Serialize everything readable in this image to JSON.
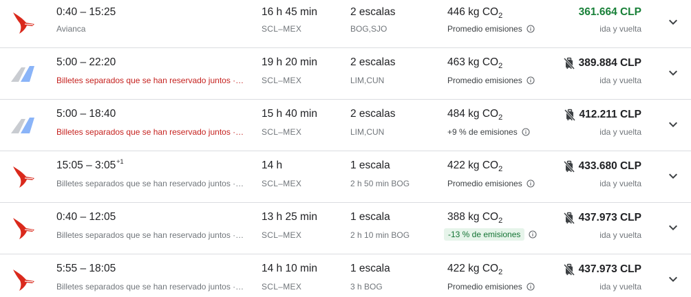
{
  "colors": {
    "warning_text": "#c5221f",
    "price_green": "#188038",
    "emission_badge_bg": "#e6f4ea",
    "emission_badge_text": "#137333",
    "avianca_red": "#da291c",
    "logo_blue": "#8ab4f8"
  },
  "flights": [
    {
      "airline_icon": "avianca-logo-icon",
      "time": "0:40 – 15:25",
      "time_suffix": "",
      "subtitle": "Avianca",
      "subtitle_is_warning": false,
      "duration": "16 h 45 min",
      "route": "SCL–MEX",
      "stops": "2 escalas",
      "stop_details": "BOG,SJO",
      "co2_value": "446 kg CO",
      "co2_subscript": "2",
      "emissions": "Promedio emisiones",
      "emissions_badge": false,
      "price": "361.664 CLP",
      "price_is_green": true,
      "no_bag_icon": false,
      "trip_type": "ida y vuelta"
    },
    {
      "airline_icon": "multi-airline-logo-icon",
      "time": "5:00 – 22:20",
      "time_suffix": "",
      "subtitle": "Billetes separados que se han reservado juntos ·…",
      "subtitle_is_warning": true,
      "duration": "19 h 20 min",
      "route": "SCL–MEX",
      "stops": "2 escalas",
      "stop_details": "LIM,CUN",
      "co2_value": "463 kg CO",
      "co2_subscript": "2",
      "emissions": "Promedio emisiones",
      "emissions_badge": false,
      "price": "389.884 CLP",
      "price_is_green": false,
      "no_bag_icon": true,
      "trip_type": "ida y vuelta"
    },
    {
      "airline_icon": "multi-airline-logo-icon",
      "time": "5:00 – 18:40",
      "time_suffix": "",
      "subtitle": "Billetes separados que se han reservado juntos ·…",
      "subtitle_is_warning": true,
      "duration": "15 h 40 min",
      "route": "SCL–MEX",
      "stops": "2 escalas",
      "stop_details": "LIM,CUN",
      "co2_value": "484 kg CO",
      "co2_subscript": "2",
      "emissions": "+9 % de emisiones",
      "emissions_badge": false,
      "price": "412.211 CLP",
      "price_is_green": false,
      "no_bag_icon": true,
      "trip_type": "ida y vuelta"
    },
    {
      "airline_icon": "avianca-logo-icon",
      "time": "15:05 – 3:05",
      "time_suffix": "+1",
      "subtitle": "Billetes separados que se han reservado juntos ·…",
      "subtitle_is_warning": false,
      "duration": "14 h",
      "route": "SCL–MEX",
      "stops": "1 escala",
      "stop_details": "2 h 50 min BOG",
      "co2_value": "422 kg CO",
      "co2_subscript": "2",
      "emissions": "Promedio emisiones",
      "emissions_badge": false,
      "price": "433.680 CLP",
      "price_is_green": false,
      "no_bag_icon": true,
      "trip_type": "ida y vuelta"
    },
    {
      "airline_icon": "avianca-logo-icon",
      "time": "0:40 – 12:05",
      "time_suffix": "",
      "subtitle": "Billetes separados que se han reservado juntos ·…",
      "subtitle_is_warning": false,
      "duration": "13 h 25 min",
      "route": "SCL–MEX",
      "stops": "1 escala",
      "stop_details": "2 h 10 min BOG",
      "co2_value": "388 kg CO",
      "co2_subscript": "2",
      "emissions": "-13 % de emisiones",
      "emissions_badge": true,
      "price": "437.973 CLP",
      "price_is_green": false,
      "no_bag_icon": true,
      "trip_type": "ida y vuelta"
    },
    {
      "airline_icon": "avianca-logo-icon",
      "time": "5:55 – 18:05",
      "time_suffix": "",
      "subtitle": "Billetes separados que se han reservado juntos ·…",
      "subtitle_is_warning": false,
      "duration": "14 h 10 min",
      "route": "SCL–MEX",
      "stops": "1 escala",
      "stop_details": "3 h BOG",
      "co2_value": "422 kg CO",
      "co2_subscript": "2",
      "emissions": "Promedio emisiones",
      "emissions_badge": false,
      "price": "437.973 CLP",
      "price_is_green": false,
      "no_bag_icon": true,
      "trip_type": "ida y vuelta"
    }
  ]
}
